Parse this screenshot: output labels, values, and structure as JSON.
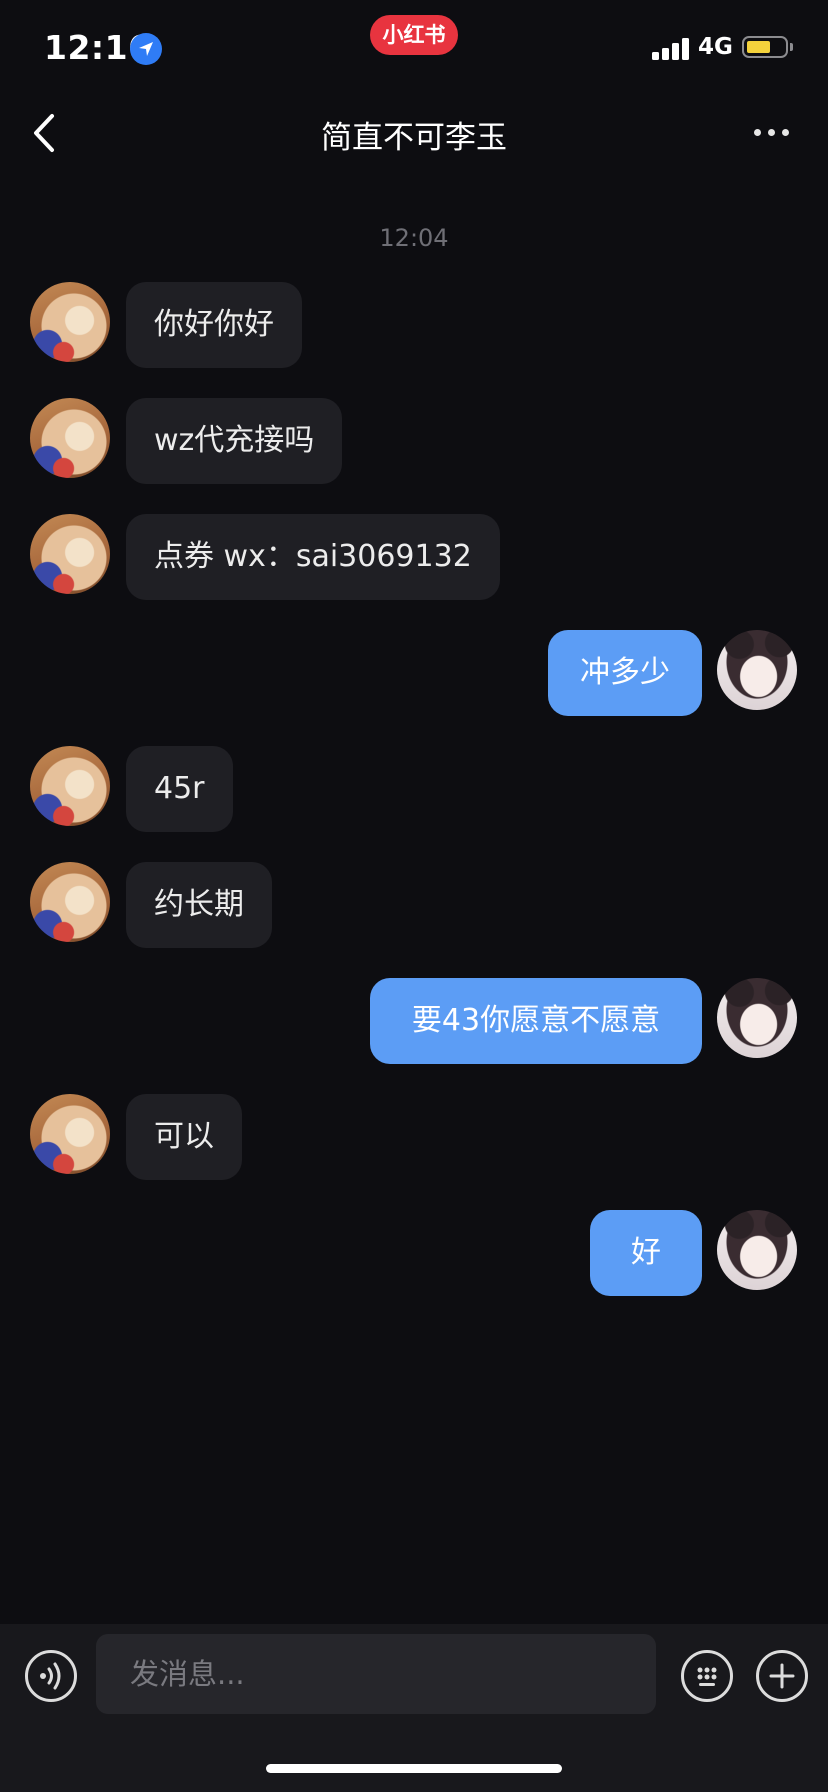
{
  "status_bar": {
    "time": "12:16",
    "app_badge": "小红书",
    "network": "4G",
    "battery_level": 0.6,
    "colors": {
      "location": "#2f7cf6",
      "battery": "#f4d23c",
      "badge": "#e8343f"
    }
  },
  "header": {
    "title": "简直不可李玉",
    "icons": {
      "back": "chevron-left-icon",
      "more": "ellipsis-icon"
    }
  },
  "conversation": {
    "timestamp": "12:04",
    "messages": [
      {
        "sender": "other",
        "text": "你好你好"
      },
      {
        "sender": "other",
        "text": "wz代充接吗"
      },
      {
        "sender": "other",
        "text": "点券 wx：sai3069132"
      },
      {
        "sender": "me",
        "text": "冲多少"
      },
      {
        "sender": "other",
        "text": "45r"
      },
      {
        "sender": "other",
        "text": "约长期"
      },
      {
        "sender": "me",
        "text": "要43你愿意不愿意"
      },
      {
        "sender": "other",
        "text": "可以"
      },
      {
        "sender": "me",
        "text": "好"
      }
    ],
    "colors": {
      "incoming_bubble": "#1f1f24",
      "outgoing_bubble": "#5c9df5"
    }
  },
  "input_bar": {
    "placeholder": "发消息...",
    "value": "",
    "icons": {
      "voice": "voice-icon",
      "emoji": "emoji-icon",
      "plus": "plus-icon"
    }
  }
}
